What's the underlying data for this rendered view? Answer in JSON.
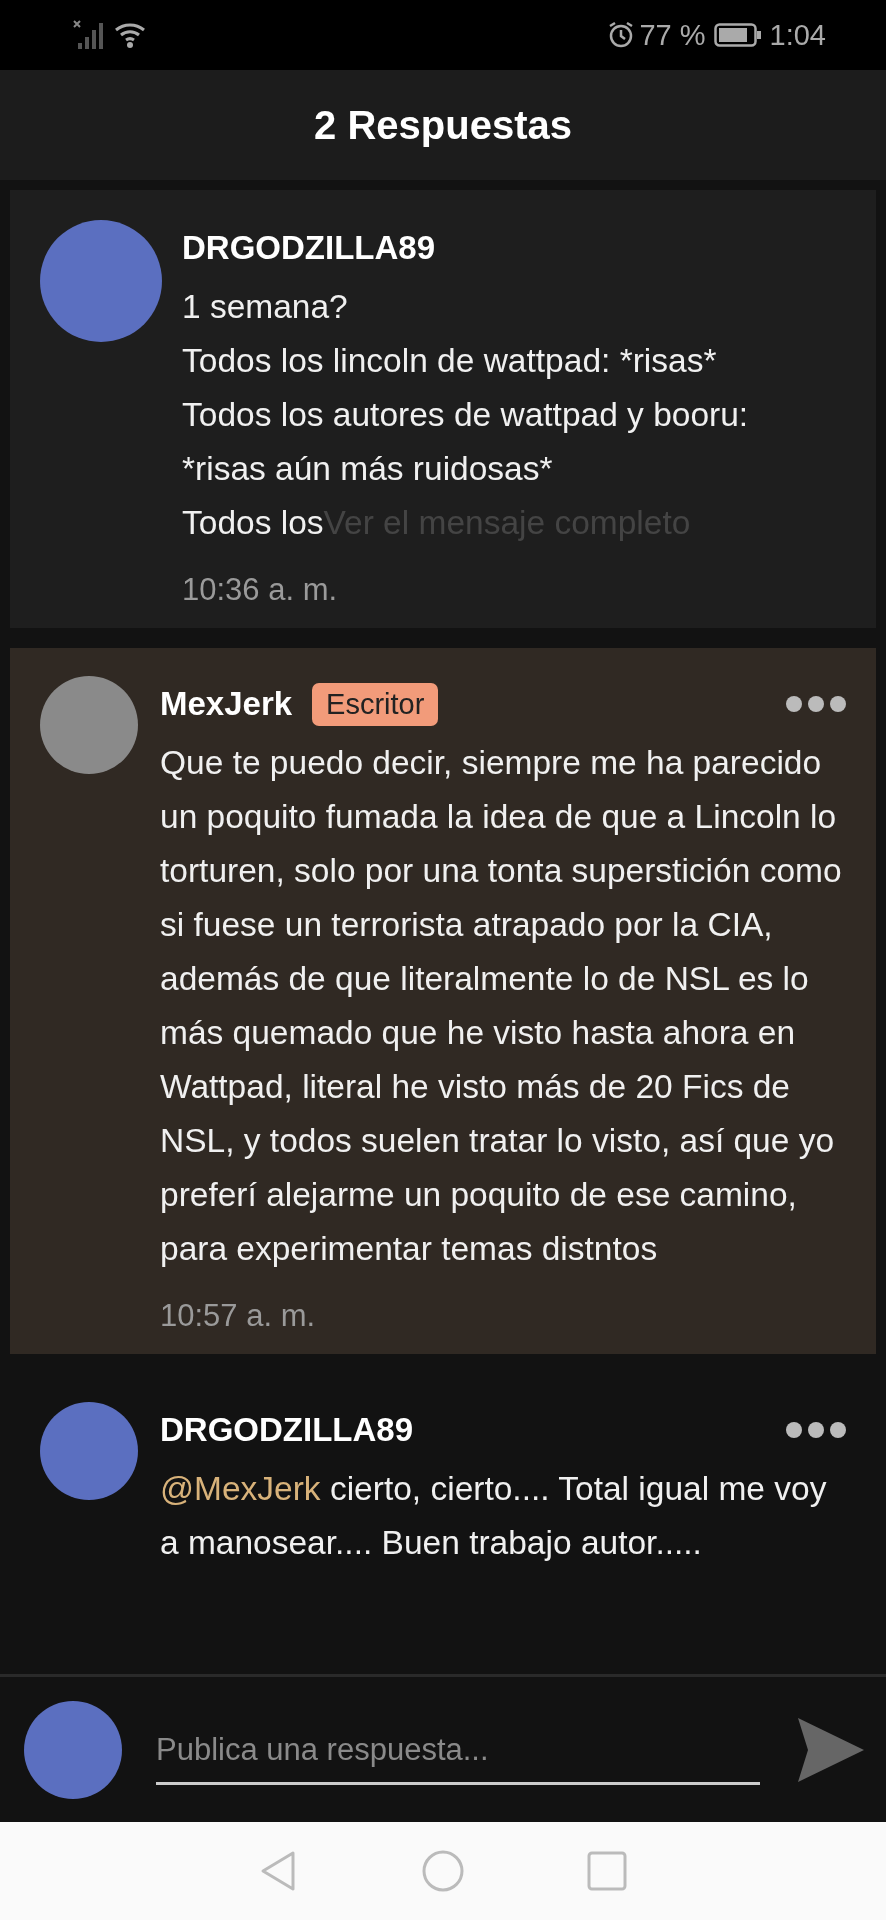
{
  "status_bar": {
    "battery": "77 %",
    "time": "1:04"
  },
  "header": {
    "title": "2 Respuestas"
  },
  "comments": [
    {
      "author": "DRGODZILLA89",
      "highlighted": false,
      "menu": false,
      "body": "1 semana?\nTodos los lincoln de wattpad: *risas*\nTodos los autores de wattpad y booru:\n*risas aún más ruidosas*\nTodos los",
      "more_link": "Ver el mensaje completo",
      "time": "10:36 a. m."
    },
    {
      "author": "MexJerk",
      "badge": "Escritor",
      "highlighted": true,
      "menu": true,
      "body": "Que te puedo decir, siempre me ha parecido un poquito fumada la idea de que a Lincoln lo torturen, solo por una tonta superstición como si fuese un terrorista atrapado por la CIA, además de que literalmente lo de NSL es lo más quemado que he visto hasta ahora en Wattpad, literal he visto más de 20 Fics de NSL, y todos suelen tratar lo visto, así que yo preferí alejarme un poquito de ese camino, para experimentar temas distntos",
      "time": "10:57 a. m."
    },
    {
      "author": "DRGODZILLA89",
      "highlighted": false,
      "menu": true,
      "mention": "@MexJerk",
      "body": " cierto, cierto.... Total igual me voy a manosear.... Buen trabajo autor....."
    }
  ],
  "reply_bar": {
    "placeholder": "Publica una respuesta..."
  }
}
